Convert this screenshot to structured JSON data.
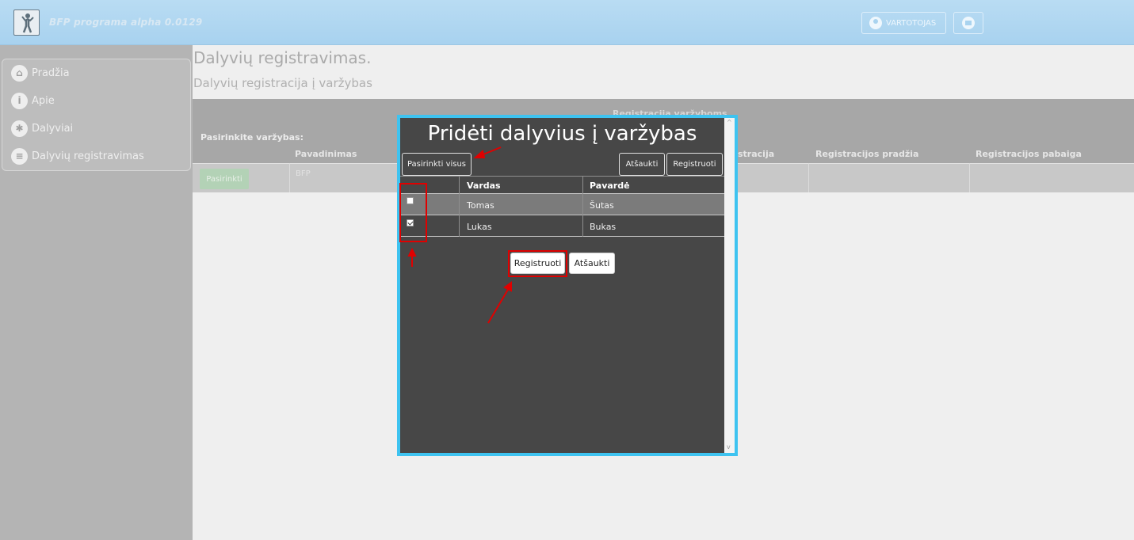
{
  "header": {
    "app_title": "BFP programa alpha 0.0129",
    "user_label": "VARTOTOJAS",
    "logo_icon": "athlete-logo",
    "user_icon": "user-circle-icon",
    "logout_icon": "logout-icon"
  },
  "sidebar": {
    "items": [
      {
        "label": "Pradžia",
        "icon": "home-icon"
      },
      {
        "label": "Apie",
        "icon": "info-icon"
      },
      {
        "label": "Dalyviai",
        "icon": "runner-icon"
      },
      {
        "label": "Dalyvių registravimas",
        "icon": "list-icon"
      }
    ]
  },
  "page": {
    "title": "Dalyvių registravimas.",
    "subtitle": "Dalyvių registracija į varžybas"
  },
  "background_table": {
    "section_title": "Registracija varžyboms",
    "choose_label": "Pasirinkite varžybas:",
    "columns": [
      "Pavadinimas",
      "Registracija",
      "Registracijos pradžia",
      "Registracijos pabaiga"
    ],
    "visible_column_fragment": "stracija",
    "row": {
      "button": "Pasirinkti",
      "name": "BFP"
    }
  },
  "modal": {
    "title": "Pridėti dalyvius į varžybas",
    "select_all": "Pasirinkti visus",
    "cancel_top": "Atšaukti",
    "register_top": "Registruoti",
    "columns": [
      "",
      "Vardas",
      "Pavardė"
    ],
    "rows": [
      {
        "checked": false,
        "vardas": "Tomas",
        "pavarde": "Šutas"
      },
      {
        "checked": true,
        "vardas": "Lukas",
        "pavarde": "Bukas"
      }
    ],
    "register_bottom": "Registruoti",
    "cancel_bottom": "Atšaukti"
  },
  "colors": {
    "header_bg": "#a8d2ef",
    "modal_bg": "#474747",
    "modal_border": "#3ec3f0",
    "annotation": "#e00000"
  }
}
